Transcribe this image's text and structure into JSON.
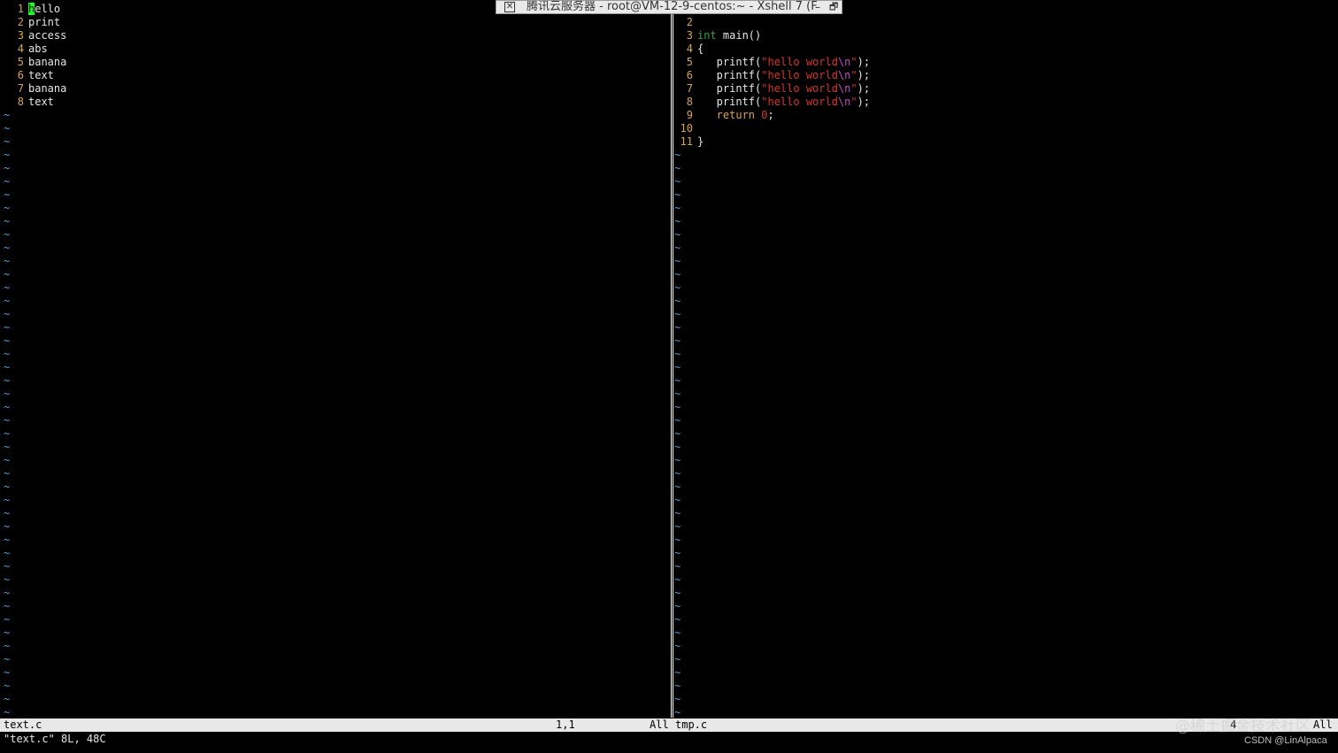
{
  "window": {
    "title": "腾讯云服务器 - root@VM-12-9-centos:~ - Xshell 7 (F",
    "pin_icon": "pin-icon",
    "minimize_icon": "minimize-icon",
    "restore_icon": "restore-icon"
  },
  "left_pane": {
    "lines": [
      {
        "n": "1",
        "text": "ello",
        "cursor_char": "h"
      },
      {
        "n": "2",
        "text": "print"
      },
      {
        "n": "3",
        "text": "access"
      },
      {
        "n": "4",
        "text": "abs"
      },
      {
        "n": "5",
        "text": "banana"
      },
      {
        "n": "6",
        "text": "text"
      },
      {
        "n": "7",
        "text": "banana"
      },
      {
        "n": "8",
        "text": "text"
      }
    ],
    "empty_marker": "~"
  },
  "right_pane": {
    "lines": [
      {
        "n": "2",
        "parts": []
      },
      {
        "n": "3",
        "parts": [
          {
            "t": "int",
            "c": "kw-type"
          },
          {
            "t": " main()",
            "c": "txt"
          }
        ]
      },
      {
        "n": "4",
        "parts": [
          {
            "t": "{",
            "c": "txt"
          }
        ]
      },
      {
        "n": "5",
        "parts": [
          {
            "t": "   printf(",
            "c": "txt"
          },
          {
            "t": "\"hello world",
            "c": "str"
          },
          {
            "t": "\\n",
            "c": "esc"
          },
          {
            "t": "\"",
            "c": "str"
          },
          {
            "t": ");",
            "c": "txt"
          }
        ]
      },
      {
        "n": "6",
        "parts": [
          {
            "t": "   printf(",
            "c": "txt"
          },
          {
            "t": "\"hello world",
            "c": "str"
          },
          {
            "t": "\\n",
            "c": "esc"
          },
          {
            "t": "\"",
            "c": "str"
          },
          {
            "t": ");",
            "c": "txt"
          }
        ]
      },
      {
        "n": "7",
        "parts": [
          {
            "t": "   printf(",
            "c": "txt"
          },
          {
            "t": "\"hello world",
            "c": "str"
          },
          {
            "t": "\\n",
            "c": "esc"
          },
          {
            "t": "\"",
            "c": "str"
          },
          {
            "t": ");",
            "c": "txt"
          }
        ]
      },
      {
        "n": "8",
        "parts": [
          {
            "t": "   printf(",
            "c": "txt"
          },
          {
            "t": "\"hello world",
            "c": "str"
          },
          {
            "t": "\\n",
            "c": "esc"
          },
          {
            "t": "\"",
            "c": "str"
          },
          {
            "t": ");",
            "c": "txt"
          }
        ]
      },
      {
        "n": "9",
        "parts": [
          {
            "t": "   return ",
            "c": "kw-stmt"
          },
          {
            "t": "0",
            "c": "numlit"
          },
          {
            "t": ";",
            "c": "txt"
          }
        ]
      },
      {
        "n": "10",
        "parts": []
      },
      {
        "n": "11",
        "parts": [
          {
            "t": "}",
            "c": "txt"
          }
        ]
      }
    ],
    "empty_marker": "~"
  },
  "statusbar": {
    "left_file": "text.c",
    "left_pos": "1,1",
    "left_pct": "All",
    "right_file": "tmp.c",
    "right_pos": "4",
    "right_pct": "All"
  },
  "cmdline": "\"text.c\" 8L, 48C",
  "watermark": "@稀土掘金技术社区",
  "credit": "CSDN @LinAlpaca",
  "colors": {
    "line_number": "#d9a34a",
    "tilde": "#4aa3df",
    "cursor": "#19ff19",
    "type_keyword": "#2ea043",
    "string": "#d8342c",
    "escape": "#c248c2"
  }
}
